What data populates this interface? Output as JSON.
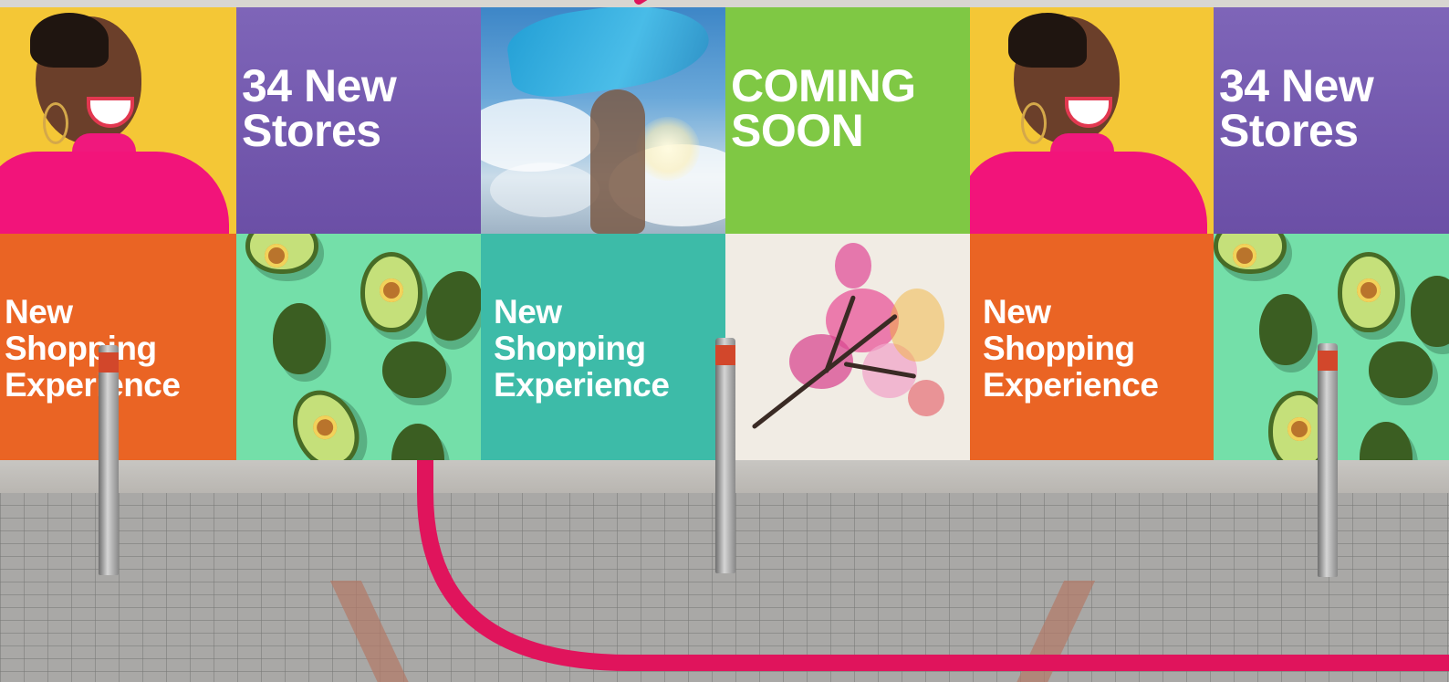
{
  "billboard": {
    "stores_headline": "34 New\nStores",
    "coming_soon_headline": "COMING\nSOON",
    "shopping_headline": "New\nShopping\nExperience"
  },
  "colors": {
    "yellow": "#f4c736",
    "purple": "#6b4fa6",
    "green": "#7fc844",
    "orange": "#ea6424",
    "mint": "#74dfa9",
    "teal": "#3dbba8",
    "magenta_line": "#e0145c"
  }
}
